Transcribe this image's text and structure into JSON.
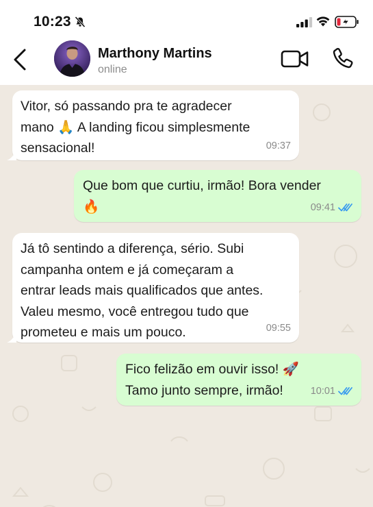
{
  "status_bar": {
    "time": "10:23"
  },
  "header": {
    "name": "Marthony Martins",
    "status": "online"
  },
  "messages": [
    {
      "direction": "in",
      "text": "Vitor, só passando pra te agradecer\nmano 🙏 A landing ficou simplesmente\nsensacional!",
      "time": "09:37"
    },
    {
      "direction": "out",
      "text": "Que bom que curtiu, irmão! Bora vender\n🔥",
      "time": "09:41",
      "read": true
    },
    {
      "direction": "in",
      "text": "Já tô sentindo a diferença, sério. Subi\ncampanha ontem e já começaram a\nentrar leads mais qualificados que antes.\nValeu mesmo, você entregou tudo que\nprometeu e mais um pouco.",
      "time": "09:55"
    },
    {
      "direction": "out",
      "text": "Fico felizão em ouvir isso! 🚀\nTamo junto sempre, irmão!",
      "time": "10:01",
      "read": true
    }
  ],
  "colors": {
    "incoming_bubble": "#ffffff",
    "outgoing_bubble": "#d8fdd2",
    "read_ticks": "#3a9bef",
    "wallpaper": "#efe9e1"
  }
}
